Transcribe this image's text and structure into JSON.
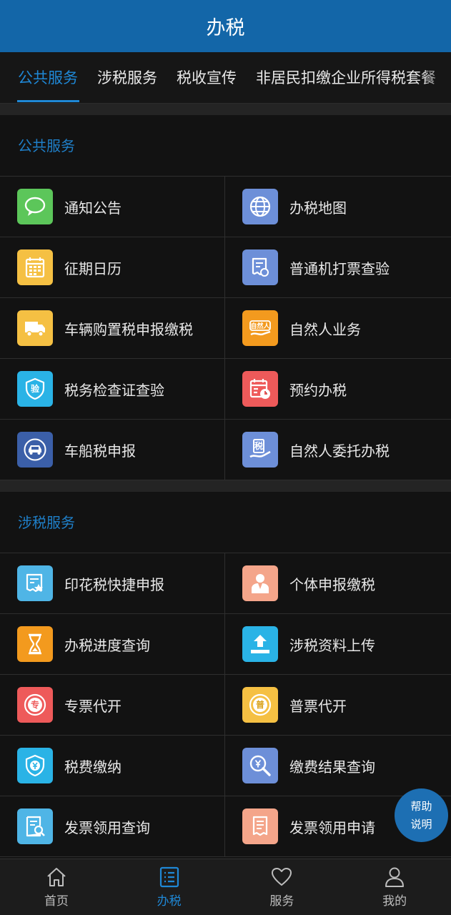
{
  "header": {
    "title": "办税"
  },
  "tabs": [
    {
      "label": "公共服务",
      "active": true
    },
    {
      "label": "涉税服务",
      "active": false
    },
    {
      "label": "税收宣传",
      "active": false
    },
    {
      "label": "非居民扣缴企业所得税套餐",
      "active": false
    }
  ],
  "sections": [
    {
      "title": "公共服务",
      "items": [
        {
          "label": "通知公告",
          "icon": "chat-bubble-icon",
          "color": "#5cc65a"
        },
        {
          "label": "办税地图",
          "icon": "globe-icon",
          "color": "#6d8fd8"
        },
        {
          "label": "征期日历",
          "icon": "calendar-icon",
          "color": "#f5c043"
        },
        {
          "label": "普通机打票查验",
          "icon": "receipt-check-icon",
          "color": "#6d8fd8"
        },
        {
          "label": "车辆购置税申报缴税",
          "icon": "truck-icon",
          "color": "#f5c043"
        },
        {
          "label": "自然人业务",
          "icon": "person-hand-icon",
          "color": "#f39a1e",
          "badge": "自然人"
        },
        {
          "label": "税务检查证查验",
          "icon": "shield-icon",
          "color": "#2ab3e6",
          "badge": "验"
        },
        {
          "label": "预约办税",
          "icon": "calendar-clock-icon",
          "color": "#ee5a5a"
        },
        {
          "label": "车船税申报",
          "icon": "car-icon",
          "color": "#3b5fa8"
        },
        {
          "label": "自然人委托办税",
          "icon": "hand-document-icon",
          "color": "#6d8fd8",
          "badge": "税"
        }
      ]
    },
    {
      "title": "涉税服务",
      "items": [
        {
          "label": "印花税快捷申报",
          "icon": "stamp-document-icon",
          "color": "#4fb5e6"
        },
        {
          "label": "个体申报缴税",
          "icon": "person-tie-icon",
          "color": "#f4a58a"
        },
        {
          "label": "办税进度查询",
          "icon": "hourglass-icon",
          "color": "#f39a1e"
        },
        {
          "label": "涉税资料上传",
          "icon": "upload-icon",
          "color": "#2ab3e6"
        },
        {
          "label": "专票代开",
          "icon": "special-invoice-icon",
          "color": "#ee5a5a",
          "badge": "专"
        },
        {
          "label": "普票代开",
          "icon": "general-invoice-icon",
          "color": "#f5c043",
          "badge": "普"
        },
        {
          "label": "税费缴纳",
          "icon": "yuan-shield-icon",
          "color": "#2ab3e6"
        },
        {
          "label": "缴费结果查询",
          "icon": "yuan-search-icon",
          "color": "#6d8fd8"
        },
        {
          "label": "发票领用查询",
          "icon": "invoice-search-icon",
          "color": "#4fb5e6"
        },
        {
          "label": "发票领用申请",
          "icon": "invoice-apply-icon",
          "color": "#f4a58a"
        }
      ]
    }
  ],
  "help": {
    "line1": "帮助",
    "line2": "说明"
  },
  "bottom_nav": [
    {
      "label": "首页",
      "icon": "home-icon",
      "active": false
    },
    {
      "label": "办税",
      "icon": "list-icon",
      "active": true
    },
    {
      "label": "服务",
      "icon": "heart-icon",
      "active": false
    },
    {
      "label": "我的",
      "icon": "user-icon",
      "active": false
    }
  ]
}
